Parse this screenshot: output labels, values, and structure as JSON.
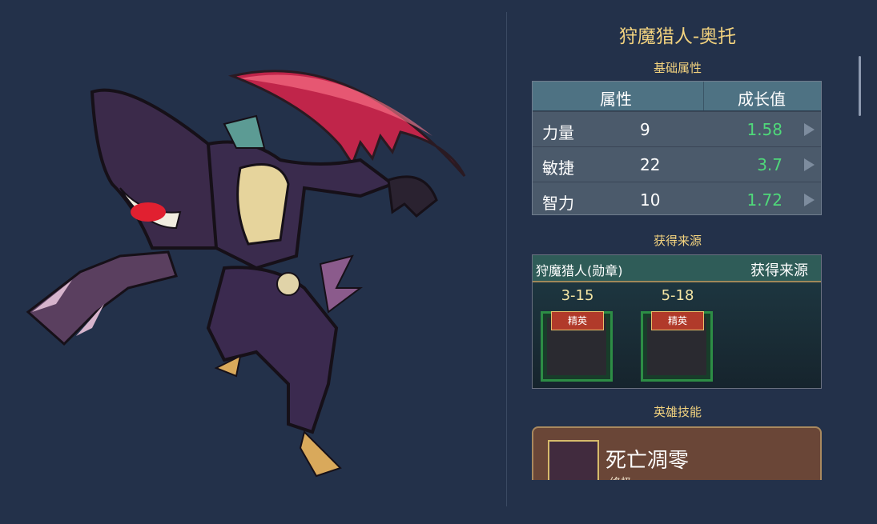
{
  "hero": {
    "title": "狩魔猎人-奥托",
    "portrait_icon": "shark-reaper-hero-art"
  },
  "sections": {
    "base_stats": "基础属性",
    "sources": "获得来源",
    "skills": "英雄技能"
  },
  "stats_table": {
    "headers": [
      "属性",
      "成长值"
    ],
    "rows": [
      {
        "name": "力量",
        "value": "9",
        "growth": "1.58"
      },
      {
        "name": "敏捷",
        "value": "22",
        "growth": "3.7"
      },
      {
        "name": "智力",
        "value": "10",
        "growth": "1.72"
      }
    ],
    "growth_color": "#4fd87a"
  },
  "source": {
    "item_name": "狩魔猎人(勋章)",
    "header_right": "获得来源",
    "stages": [
      {
        "label": "3-15",
        "tier": "精英"
      },
      {
        "label": "5-18",
        "tier": "精英"
      }
    ]
  },
  "skill": {
    "name": "死亡凋零",
    "subtitle": "终极"
  },
  "colors": {
    "background": "#23314a",
    "gold_text": "#f3d37f",
    "elite_ribbon": "#b13a2a",
    "card_border": "#2d8d45"
  }
}
